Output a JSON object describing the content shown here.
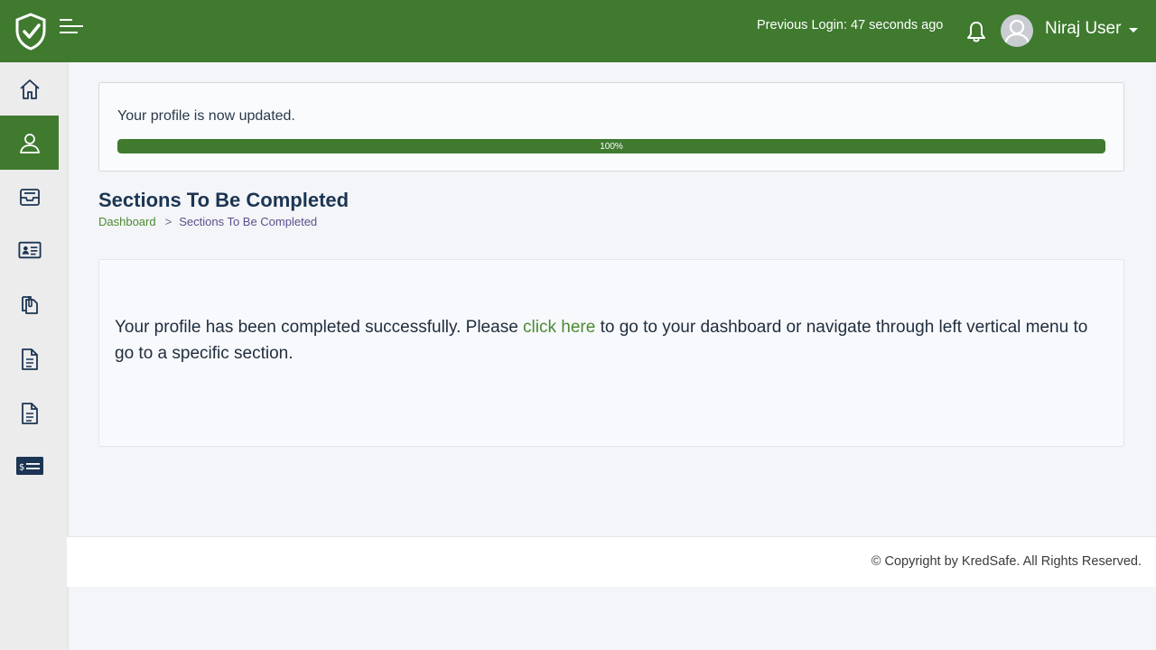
{
  "header": {
    "previous_login": "Previous Login: 47 seconds ago",
    "username": "Niraj User"
  },
  "sidebar": {
    "items": [
      {
        "icon": "home-icon",
        "active": false
      },
      {
        "icon": "user-icon",
        "active": true
      },
      {
        "icon": "inbox-tray-icon",
        "active": false
      },
      {
        "icon": "id-card-icon",
        "active": false
      },
      {
        "icon": "documents-clip-icon",
        "active": false
      },
      {
        "icon": "document-icon",
        "active": false
      },
      {
        "icon": "document-icon",
        "active": false
      },
      {
        "icon": "payment-card-icon",
        "active": false
      }
    ]
  },
  "progress": {
    "message": "Your profile is now updated.",
    "percent": 100,
    "label": "100%"
  },
  "page": {
    "title": "Sections To Be Completed",
    "breadcrumb": {
      "home": "Dashboard",
      "separator": ">",
      "current": "Sections To Be Completed"
    }
  },
  "content": {
    "text_before": "Your profile has been completed successfully. Please ",
    "link_text": "click here",
    "text_after": " to go to your dashboard or navigate through left vertical menu to go to a specific section."
  },
  "footer": {
    "copyright": "© Copyright by KredSafe. All Rights Reserved."
  },
  "colors": {
    "brand_green": "#3f7a2f",
    "link_green": "#4a8a33",
    "title_navy": "#1b3553"
  }
}
